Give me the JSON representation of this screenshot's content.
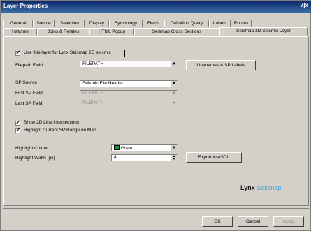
{
  "window": {
    "title": "Layer Properties",
    "help_close": "?|x"
  },
  "tabs_row1": [
    "General",
    "Source",
    "Selection",
    "Display",
    "Symbology",
    "Fields",
    "Definition Query",
    "Labels",
    "Routes"
  ],
  "tabs_row2": [
    "Hatches",
    "Joins & Relates",
    "HTML Popup",
    "Seismap Cross Sections",
    "Seismap 2D Seismic Layer"
  ],
  "form": {
    "use_layer_label": "Use this layer for Lynx Seismap 2D seismic",
    "filepath_field_label": "Filepath Field",
    "filepath_field_value": "FILEPATH",
    "linenames_button": "Linenames & SP Labels",
    "sp_source_label": "SP Source",
    "sp_source_value": "Seismic File Header",
    "first_sp_label": "First SP Field",
    "first_sp_value": "FILEPATH",
    "last_sp_label": "Last SP Field",
    "last_sp_value": "FILEPATH",
    "show_intersections_label": "Show 2D Line Intersections",
    "highlight_range_label": "Highlight Current SP Range on Map",
    "highlight_colour_label": "Highlight Colour",
    "highlight_colour_value": "Green",
    "highlight_width_label": "Highlight Width (px)",
    "highlight_width_value": "4",
    "export_button": "Export to ASCII"
  },
  "logo": {
    "part1": "Lynx",
    "part2": "Seismap"
  },
  "buttons": {
    "ok": "OK",
    "cancel": "Cancel",
    "apply": "Apply"
  },
  "colors": {
    "highlight_green": "#00a030",
    "logo_blue": "#3aa0d8"
  }
}
